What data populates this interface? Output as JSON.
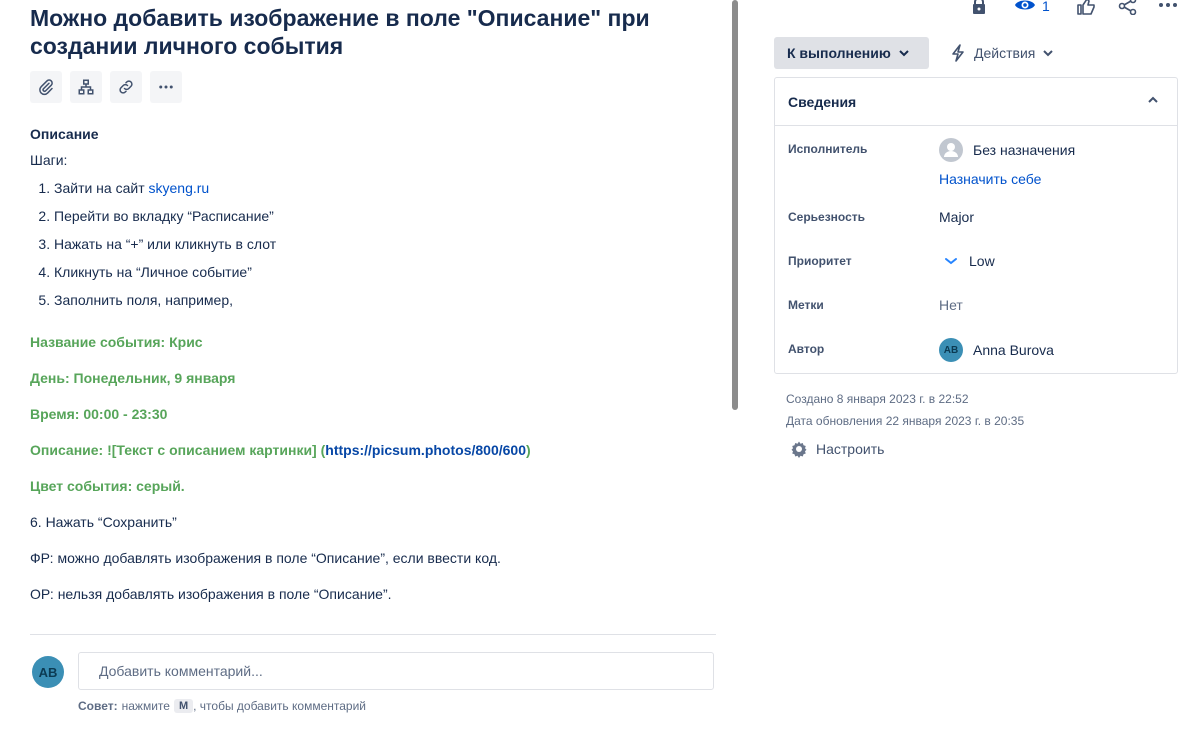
{
  "issue": {
    "title": "Можно добавить изображение в поле \"Описание\" при создании личного события"
  },
  "toolbar": {
    "icons": [
      "attach-icon",
      "hierarchy-icon",
      "link-icon",
      "more-icon"
    ]
  },
  "description": {
    "heading": "Описание",
    "steps_label": "Шаги:",
    "steps": [
      {
        "text": "Зайти на сайт ",
        "link": "skyeng.ru"
      },
      {
        "text": "Перейти во вкладку “Расписание”"
      },
      {
        "text": "Нажать на “+” или кликнуть в слот"
      },
      {
        "text": "Кликнуть на “Личное событие”"
      },
      {
        "text": "Заполнить поля, например,"
      }
    ],
    "fields": {
      "name": "Название события: Крис",
      "day": "День: Понедельник, 9 января",
      "time": "Время: 00:00 - 23:30",
      "desc_prefix": "Описание: ![Текст с описанием картинки] (",
      "desc_link": "https://picsum.photos/800/600",
      "desc_suffix": ")",
      "color": "Цвет события: серый."
    },
    "step6": "6. Нажать “Сохранить”",
    "expected": "ФР: можно добавлять изображения в поле “Описание”, если ввести код.",
    "actual": "ОР: нельзя добавлять изображения в поле “Описание”."
  },
  "comment": {
    "avatar": "AB",
    "placeholder": "Добавить комментарий...",
    "tip_bold": "Совет:",
    "tip_pre": "нажмите",
    "tip_key": "M",
    "tip_post": ", чтобы добавить комментарий"
  },
  "header_actions": {
    "watch_count": "1"
  },
  "status": {
    "label": "К выполнению",
    "actions_label": "Действия"
  },
  "details": {
    "heading": "Сведения",
    "assignee_label": "Исполнитель",
    "assignee_value": "Без назначения",
    "assign_self": "Назначить себе",
    "severity_label": "Серьезность",
    "severity_value": "Major",
    "priority_label": "Приоритет",
    "priority_value": "Low",
    "labels_label": "Метки",
    "labels_value": "Нет",
    "reporter_label": "Автор",
    "reporter_avatar": "AB",
    "reporter_value": "Anna Burova"
  },
  "meta": {
    "created": "Создано 8 января 2023 г. в 22:52",
    "updated": "Дата обновления 22 января 2023 г. в 20:35",
    "configure": "Настроить"
  },
  "colors": {
    "green": "#57a55a",
    "link": "#0052cc",
    "avatar": "#3b8fb5"
  }
}
